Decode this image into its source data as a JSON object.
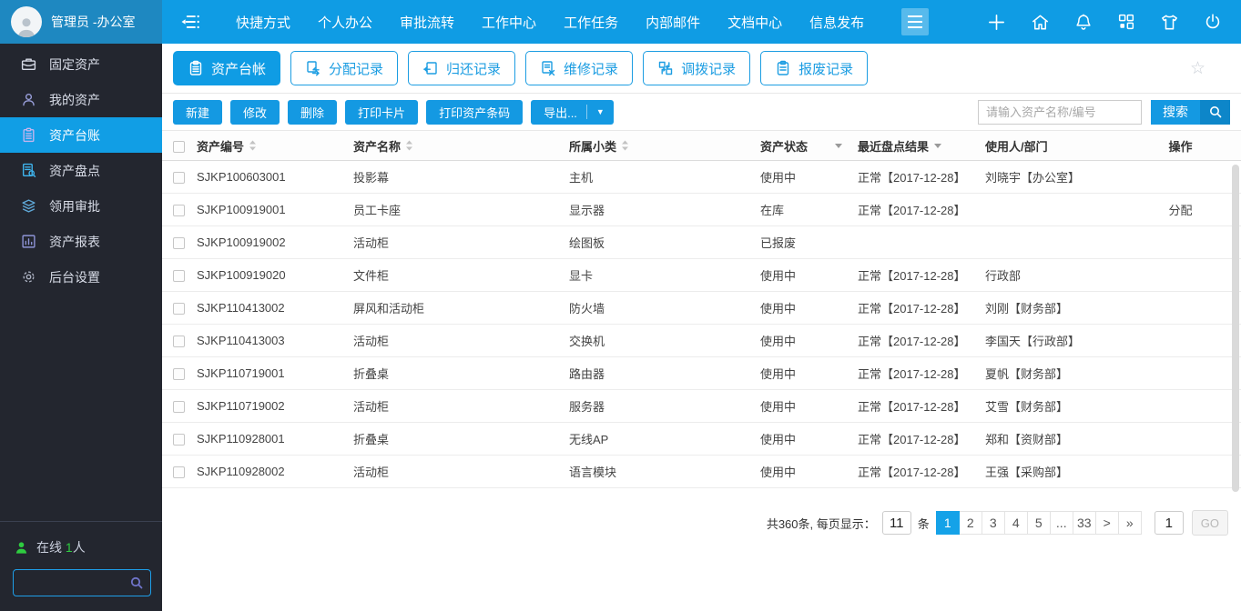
{
  "colors": {
    "accent": "#0f9ce4",
    "topbar_left": "#1e88c1",
    "sidebar_bg": "#23262f",
    "online_green": "#2ecc40",
    "search_dark": "#0d86c9"
  },
  "topbar": {
    "username": "管理员 -办公室",
    "nav": [
      "快捷方式",
      "个人办公",
      "审批流转",
      "工作中心",
      "工作任务",
      "内部邮件",
      "文档中心",
      "信息发布"
    ]
  },
  "sidebar": {
    "items": [
      {
        "label": "固定资产",
        "icon": "briefcase-icon",
        "active": false
      },
      {
        "label": "我的资产",
        "icon": "user-icon",
        "active": false
      },
      {
        "label": "资产台账",
        "icon": "ledger-icon",
        "active": true
      },
      {
        "label": "资产盘点",
        "icon": "inventory-search-icon",
        "active": false
      },
      {
        "label": "领用审批",
        "icon": "layers-icon",
        "active": false
      },
      {
        "label": "资产报表",
        "icon": "report-icon",
        "active": false
      },
      {
        "label": "后台设置",
        "icon": "gear-icon",
        "active": false
      }
    ],
    "online_prefix": "在线",
    "online_count": "1",
    "online_suffix": "人"
  },
  "tabs": [
    {
      "label": "资产台帐",
      "active": true
    },
    {
      "label": "分配记录",
      "active": false
    },
    {
      "label": "归还记录",
      "active": false
    },
    {
      "label": "维修记录",
      "active": false
    },
    {
      "label": "调拨记录",
      "active": false
    },
    {
      "label": "报废记录",
      "active": false
    }
  ],
  "toolbar": {
    "buttons": [
      "新建",
      "修改",
      "删除",
      "打印卡片",
      "打印资产条码"
    ],
    "export_label": "导出...",
    "search_placeholder": "请输入资产名称/编号",
    "search_label": "搜索"
  },
  "table": {
    "headers": [
      "资产编号",
      "资产名称",
      "所属小类",
      "资产状态",
      "最近盘点结果",
      "使用人/部门",
      "操作"
    ],
    "rows": [
      {
        "id": "SJKP100603001",
        "name": "投影幕",
        "category": "主机",
        "status": "使用中",
        "inventory": "正常【2017-12-28】",
        "user": "刘晓宇【办公室】",
        "action": ""
      },
      {
        "id": "SJKP100919001",
        "name": "员工卡座",
        "category": "显示器",
        "status": "在库",
        "inventory": "正常【2017-12-28】",
        "user": "",
        "action": "分配"
      },
      {
        "id": "SJKP100919002",
        "name": "活动柜",
        "category": "绘图板",
        "status": "已报废",
        "inventory": "",
        "user": "",
        "action": ""
      },
      {
        "id": "SJKP100919020",
        "name": "文件柜",
        "category": "显卡",
        "status": "使用中",
        "inventory": "正常【2017-12-28】",
        "user": "行政部",
        "action": ""
      },
      {
        "id": "SJKP110413002",
        "name": "屏风和活动柜",
        "category": "防火墙",
        "status": "使用中",
        "inventory": "正常【2017-12-28】",
        "user": "刘刚【财务部】",
        "action": ""
      },
      {
        "id": "SJKP110413003",
        "name": "活动柜",
        "category": "交换机",
        "status": "使用中",
        "inventory": "正常【2017-12-28】",
        "user": "李国天【行政部】",
        "action": ""
      },
      {
        "id": "SJKP110719001",
        "name": "折叠桌",
        "category": "路由器",
        "status": "使用中",
        "inventory": "正常【2017-12-28】",
        "user": "夏帆【财务部】",
        "action": ""
      },
      {
        "id": "SJKP110719002",
        "name": "活动柜",
        "category": "服务器",
        "status": "使用中",
        "inventory": "正常【2017-12-28】",
        "user": "艾雪【财务部】",
        "action": ""
      },
      {
        "id": "SJKP110928001",
        "name": "折叠桌",
        "category": "无线AP",
        "status": "使用中",
        "inventory": "正常【2017-12-28】",
        "user": "郑和【资财部】",
        "action": ""
      },
      {
        "id": "SJKP110928002",
        "name": "活动柜",
        "category": "语言模块",
        "status": "使用中",
        "inventory": "正常【2017-12-28】",
        "user": "王强【采购部】",
        "action": ""
      }
    ]
  },
  "pagination": {
    "summary": "共360条, 每页显示：",
    "per_page": "11",
    "unit": "条",
    "pages": [
      {
        "label": "1",
        "active": true
      },
      {
        "label": "2",
        "active": false
      },
      {
        "label": "3",
        "active": false
      },
      {
        "label": "4",
        "active": false
      },
      {
        "label": "5",
        "active": false
      },
      {
        "label": "...",
        "active": false
      },
      {
        "label": "33",
        "active": false
      },
      {
        "label": ">",
        "active": false
      },
      {
        "label": "»",
        "active": false
      }
    ],
    "goto_value": "1",
    "go_label": "GO"
  }
}
